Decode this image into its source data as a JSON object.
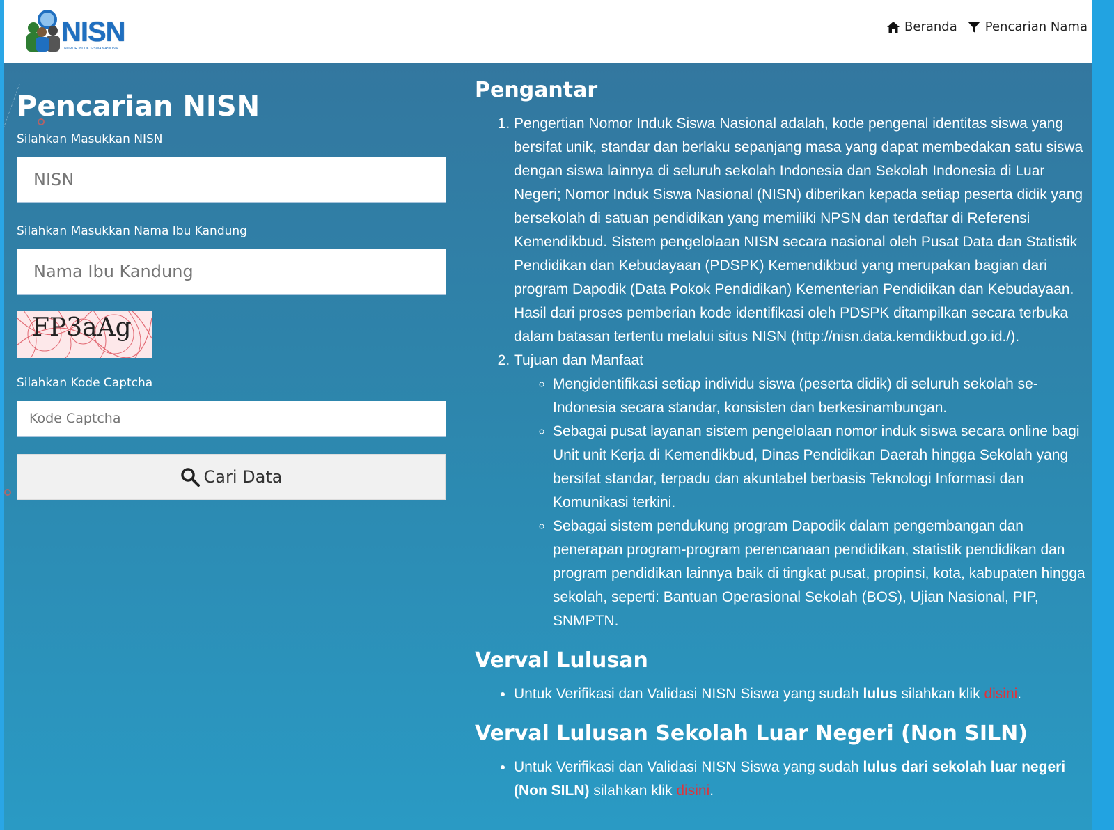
{
  "header": {
    "logo_text": "NISN",
    "logo_subtext": "NOMOR INDUK SISWA NASIONAL",
    "nav": [
      {
        "label": "Beranda",
        "icon": "home-icon"
      },
      {
        "label": "Pencarian Nama",
        "icon": "filter-icon"
      }
    ]
  },
  "form": {
    "title": "Pencarian NISN",
    "nisn_label": "Silahkan Masukkan NISN",
    "nisn_placeholder": "NISN",
    "mother_label": "Silahkan Masukkan Nama Ibu Kandung",
    "mother_placeholder": "Nama Ibu Kandung",
    "captcha_image_text": "FP3aAg",
    "captcha_label": "Silahkan Kode Captcha",
    "captcha_placeholder": "Kode Captcha",
    "search_button": "Cari Data",
    "search_icon": "search-icon"
  },
  "content": {
    "intro_title": "Pengantar",
    "item1": "Pengertian Nomor Induk Siswa Nasional adalah, kode pengenal identitas siswa yang bersifat unik, standar dan berlaku sepanjang masa yang dapat membedakan satu siswa dengan siswa lainnya di seluruh sekolah Indonesia dan Sekolah Indonesia di Luar Negeri; Nomor Induk Siswa Nasional (NISN) diberikan kepada setiap peserta didik yang bersekolah di satuan pendidikan yang memiliki NPSN dan terdaftar di Referensi Kemendikbud. Sistem pengelolaan NISN secara nasional oleh Pusat Data dan Statistik Pendidikan dan Kebudayaan (PDSPK) Kemendikbud yang merupakan bagian dari program Dapodik (Data Pokok Pendidikan) Kementerian Pendidikan dan Kebudayaan. Hasil dari proses pemberian kode identifikasi oleh PDSPK ditampilkan secara terbuka dalam batasan tertentu melalui situs NISN (http://nisn.data.kemdikbud.go.id./).",
    "item2": "Tujuan dan Manfaat",
    "subitems": [
      "Mengidentifikasi setiap individu siswa (peserta didik) di seluruh sekolah se-Indonesia secara standar, konsisten dan berkesinambungan.",
      "Sebagai pusat layanan sistem pengelolaan nomor induk siswa secara online bagi Unit unit Kerja di Kemendikbud, Dinas Pendidikan Daerah hingga Sekolah yang bersifat standar, terpadu dan akuntabel berbasis Teknologi Informasi dan Komunikasi terkini.",
      "Sebagai sistem pendukung program Dapodik dalam pengembangan dan penerapan program-program perencanaan pendidikan, statistik pendidikan dan program pendidikan lainnya baik di tingkat pusat, propinsi, kota, kabupaten hingga sekolah, seperti: Bantuan Operasional Sekolah (BOS), Ujian Nasional, PIP, SNMPTN."
    ],
    "verval_title": "Verval Lulusan",
    "verval_text_pre": "Untuk Verifikasi dan Validasi NISN Siswa yang sudah ",
    "verval_text_bold": "lulus",
    "verval_text_post": " silahkan klik ",
    "verval_link": "disini",
    "verval_end": ".",
    "siln_title": "Verval Lulusan Sekolah Luar Negeri (Non SILN)",
    "siln_text_pre": "Untuk Verifikasi dan Validasi NISN Siswa yang sudah ",
    "siln_text_bold": "lulus dari sekolah luar negeri (Non SILN)",
    "siln_text_post": " silahkan klik ",
    "siln_link": "disini",
    "siln_end": "."
  },
  "colors": {
    "header_bg": "#ffffff",
    "main_bg": "#2d86ad",
    "link": "#e0333a",
    "logo": "#1f6fc0"
  }
}
